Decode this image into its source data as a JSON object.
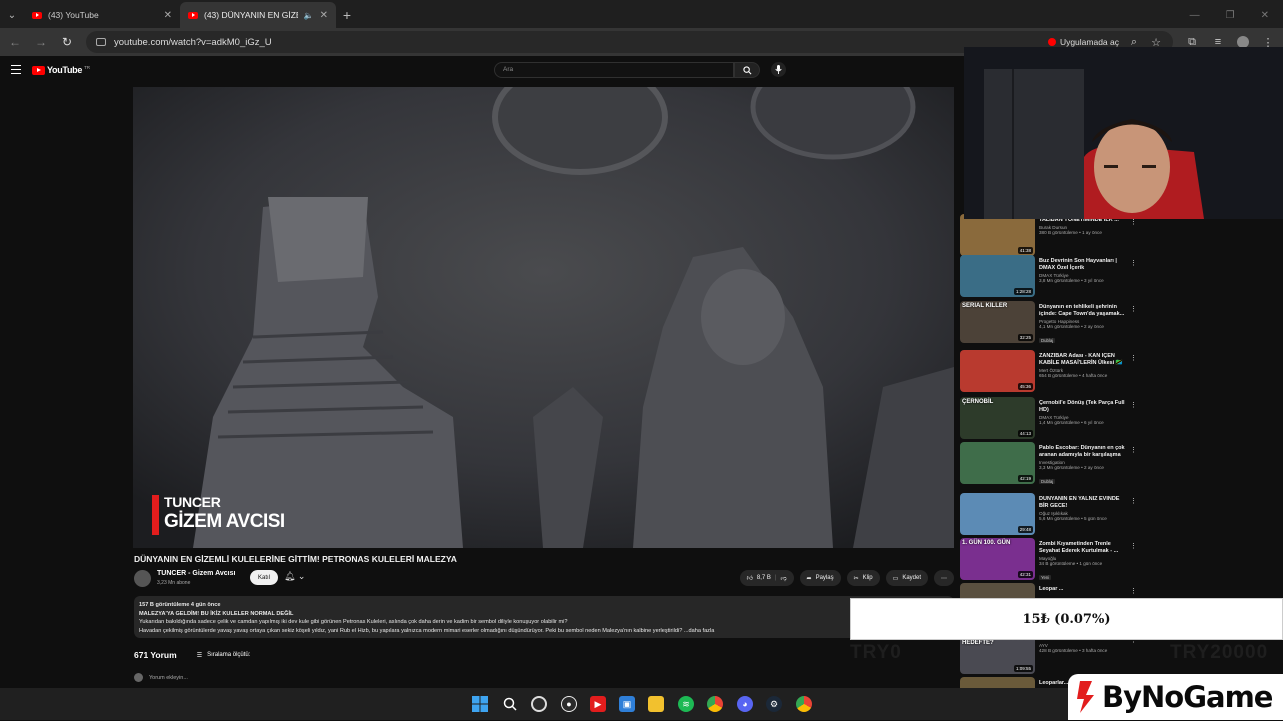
{
  "browser": {
    "tabs": [
      {
        "title": "(43) YouTube",
        "active": false
      },
      {
        "title": "(43) DÜNYANIN EN GİZEMLİ",
        "active": true
      }
    ],
    "url": "youtube.com/watch?v=adkM0_iGz_U",
    "open_in_app_label": "Uygulamada aç"
  },
  "youtube": {
    "logo": "YouTube",
    "logo_region": "TR",
    "search_placeholder": "Ara"
  },
  "video": {
    "overlay_line1": "TUNCER",
    "overlay_line2": "GİZEM AVCISI",
    "title": "DÜNYANIN EN GİZEMLİ KULELERİNE GİTTİM! PETRONAS KULELERİ MALEZYA",
    "channel_name": "TUNCER - Gizem Avcısı",
    "subscribers": "3,23 Mn abone",
    "subscribe_label": "Katıl",
    "likes": "8,7 B",
    "share_label": "Paylaş",
    "clip_label": "Klip",
    "save_label": "Kaydet",
    "description": {
      "meta": "157 B görüntüleme  4 gün önce",
      "line1": "MALEZYA'YA GELDİM! BU İKİZ KULELER NORMAL DEĞİL",
      "line2": "Yukarıdan bakıldığında sadece çelik ve camdan yapılmış iki dev kule gibi görünen Petronas Kuleleri, aslında çok daha derin ve kadim bir sembol diliyle konuşuyor olabilir mi?",
      "line3": "Havadan çekilmiş görüntülerde yavaş yavaş ortaya çıkan sekiz köşeli yıldız, yani Rub el Hizb, bu yapılara yalnızca modern mimari eserler olmadığını düşündürüyor. Peki bu sembol neden Malezya'nın kalbine yerleştirildi? ...daha fazla"
    },
    "comment_count": "671 Yorum",
    "sort_label": "Sıralama ölçütü:",
    "add_comment_placeholder": "Yorum ekleyin..."
  },
  "recommendations": [
    {
      "title": "TALİBAN YÖNETİMİNDE İLK ...",
      "channel": "Burak Dursun",
      "meta": "380 B görüntüleme • 1 ay önce",
      "duration": "41:38",
      "badge": "",
      "thumb_color": "#8a6a3c"
    },
    {
      "title": "Buz Devrinin Son Hayvanları | DMAX Özel İçerik",
      "channel": "DMAX Türkiye",
      "meta": "3,8 Mn görüntüleme • 3 yıl önce",
      "duration": "1:28:28",
      "badge": "",
      "thumb_color": "#3a6d86"
    },
    {
      "title": "Dünyanın en tehlikeli şehrinin içinde: Cape Town'da yaşamak...",
      "channel": "Progetto Happiness",
      "meta": "4,1 Mn görüntüleme • 2 ay önce",
      "duration": "32:25",
      "badge": "Dublaj",
      "thumb_color": "#4c4238",
      "thumb_text": "SERIAL KILLER"
    },
    {
      "title": "ZANZİBAR Adası - KAN İÇEN KABİLE MASAİ'LERİN Ülkesi 🇹🇿",
      "channel": "Mert Öztürk",
      "meta": "654 B görüntüleme • 4 hafta önce",
      "duration": "45:36",
      "badge": "",
      "thumb_color": "#b93a2f"
    },
    {
      "title": "Çernobil'e Dönüş (Tek Parça Full HD)",
      "channel": "DMAX Türkiye",
      "meta": "1,4 Mn görüntüleme • 6 yıl önce",
      "duration": "44:13",
      "badge": "",
      "thumb_color": "#2d3b2a",
      "thumb_text": "ÇERNOBİL"
    },
    {
      "title": "Pablo Escobar: Dünyanın en çok aranan adamıyla bir karşılaşma",
      "channel": "Investigation",
      "meta": "3,3 Mn görüntüleme • 2 ay önce",
      "duration": "42:19",
      "badge": "Dublaj",
      "thumb_color": "#3f6d4a"
    },
    {
      "title": "DÜNYANIN EN YALNIZ EVİNDE BİR GECE!",
      "channel": "Oğuz Işıklıkak",
      "meta": "5,6 Mn görüntüleme • 5 gün önce",
      "duration": "29:48",
      "badge": "",
      "thumb_color": "#5c8bb5"
    },
    {
      "title": "Zombi Kıyametinden Trenle Seyahat Ederek Kurtulmak - ...",
      "channel": "Mayoğlu",
      "meta": "34 B görüntüleme • 1 gün önce",
      "duration": "42:31",
      "badge": "Yeni",
      "thumb_color": "#7a2f8f",
      "thumb_text": "1. GÜN  100. GÜN"
    },
    {
      "title": "Leopar ...",
      "channel": "",
      "meta": "",
      "duration": "",
      "badge": "",
      "thumb_color": "#5a5040"
    },
    {
      "title": "Saldırıyor?",
      "channel": "AYV",
      "meta": "428 B görüntüleme • 3 hafta önce",
      "duration": "1:09:55",
      "badge": "",
      "thumb_color": "#4a4a52",
      "thumb_text": "VENEZUELA'YI NEDEN HEDEFTE?"
    },
    {
      "title": "Leoparlar...",
      "channel": "",
      "meta": "",
      "duration": "",
      "badge": "",
      "thumb_color": "#6a5a3a"
    }
  ],
  "stream_overlay": {
    "donation": "15₺ (0.07%)",
    "goal_start": "TRY0",
    "goal_end": "TRY20000",
    "sponsor": "ByNoGame"
  },
  "taskbar": {
    "apps": [
      "windows",
      "search",
      "chrome-beta",
      "github",
      "youtube",
      "photos",
      "files",
      "spotify",
      "chrome",
      "discord",
      "steam",
      "chrome-2"
    ]
  }
}
